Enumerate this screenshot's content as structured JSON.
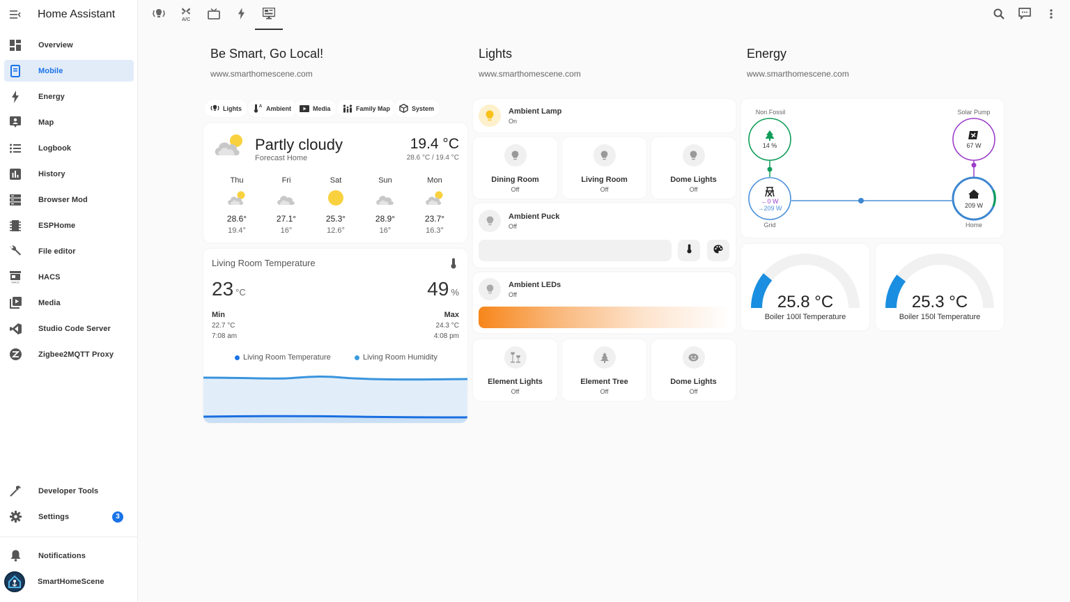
{
  "app": {
    "title": "Home Assistant"
  },
  "sidebar": {
    "items": [
      {
        "label": "Overview",
        "icon": "view-dashboard-icon",
        "active": false
      },
      {
        "label": "Mobile",
        "icon": "tablet-icon",
        "active": true
      },
      {
        "label": "Energy",
        "icon": "lightning-bolt-icon",
        "active": false
      },
      {
        "label": "Map",
        "icon": "map-account-icon",
        "active": false
      },
      {
        "label": "Logbook",
        "icon": "format-list-bulleted-icon",
        "active": false
      },
      {
        "label": "History",
        "icon": "chart-box-icon",
        "active": false
      },
      {
        "label": "Browser Mod",
        "icon": "server-icon",
        "active": false
      },
      {
        "label": "ESPHome",
        "icon": "chip-icon",
        "active": false
      },
      {
        "label": "File editor",
        "icon": "wrench-icon",
        "active": false
      },
      {
        "label": "HACS",
        "icon": "hacs-store-icon",
        "active": false
      },
      {
        "label": "Media",
        "icon": "play-box-multiple-icon",
        "active": false
      },
      {
        "label": "Studio Code Server",
        "icon": "vscode-icon",
        "active": false
      },
      {
        "label": "Zigbee2MQTT Proxy",
        "icon": "zigbee-icon",
        "active": false
      }
    ],
    "bottom": {
      "developer_tools": "Developer Tools",
      "settings": "Settings",
      "settings_badge": "3",
      "notifications": "Notifications",
      "user": "SmartHomeScene"
    }
  },
  "topbar": {
    "tabs": [
      {
        "icon": "lightbulb-group-icon",
        "active": false
      },
      {
        "icon": "air-conditioner-icon",
        "label": "A/C",
        "active": false
      },
      {
        "icon": "television-icon",
        "active": false
      },
      {
        "icon": "lightning-bolt-icon",
        "active": false
      },
      {
        "icon": "monitor-dashboard-icon",
        "active": true
      }
    ],
    "actions": [
      "search-icon",
      "assist-message-icon",
      "more-vertical-icon"
    ]
  },
  "columns": {
    "col1": {
      "title": "Be Smart, Go Local!",
      "subtitle": "www.smarthomescene.com"
    },
    "col2": {
      "title": "Lights",
      "subtitle": "www.smarthomescene.com"
    },
    "col3": {
      "title": "Energy",
      "subtitle": "www.smarthomescene.com"
    }
  },
  "chips": [
    {
      "label": "Lights",
      "icon": "lightbulb-group-icon"
    },
    {
      "label": "Ambient",
      "icon": "thermometer-auto-icon"
    },
    {
      "label": "Media",
      "icon": "youtube-tv-icon"
    },
    {
      "label": "Family Map",
      "icon": "family-icon"
    },
    {
      "label": "System",
      "icon": "package-icon"
    }
  ],
  "weather": {
    "condition": "Partly cloudy",
    "location": "Forecast Home",
    "temperature": "19.4 °C",
    "range": "28.6 °C / 19.4 °C",
    "forecast": [
      {
        "day": "Thu",
        "icon": "partly-cloudy",
        "high": "28.6°",
        "low": "19.4°"
      },
      {
        "day": "Fri",
        "icon": "cloudy",
        "high": "27.1°",
        "low": "16°"
      },
      {
        "day": "Sat",
        "icon": "sunny",
        "high": "25.3°",
        "low": "12.6°"
      },
      {
        "day": "Sun",
        "icon": "cloudy",
        "high": "28.9°",
        "low": "16°"
      },
      {
        "day": "Mon",
        "icon": "partly-cloudy",
        "high": "23.7°",
        "low": "16.3°"
      }
    ]
  },
  "sensor": {
    "title": "Living Room Temperature",
    "temp_value": "23",
    "temp_unit": "°C",
    "hum_value": "49",
    "hum_unit": "%",
    "min_label": "Min",
    "min_value": "22.7 °C",
    "min_time": "7:08 am",
    "max_label": "Max",
    "max_value": "24.3 °C",
    "max_time": "4:08 pm",
    "legend": [
      {
        "label": "Living Room Temperature",
        "color": "#1a73e8"
      },
      {
        "label": "Living Room Humidity",
        "color": "#3a9be0"
      }
    ]
  },
  "lights": {
    "ambient_lamp": {
      "name": "Ambient Lamp",
      "state": "On"
    },
    "row1": [
      {
        "name": "Dining Room",
        "state": "Off",
        "icon": "lightbulb-icon"
      },
      {
        "name": "Living Room",
        "state": "Off",
        "icon": "lightbulb-icon"
      },
      {
        "name": "Dome Lights",
        "state": "Off",
        "icon": "lightbulb-icon"
      }
    ],
    "ambient_puck": {
      "name": "Ambient Puck",
      "state": "Off"
    },
    "ambient_leds": {
      "name": "Ambient LEDs",
      "state": "Off"
    },
    "row2": [
      {
        "name": "Element Lights",
        "state": "Off",
        "icon": "floor-lamp-icon"
      },
      {
        "name": "Element Tree",
        "state": "Off",
        "icon": "pine-tree-icon"
      },
      {
        "name": "Dome Lights",
        "state": "Off",
        "icon": "dome-light-icon"
      }
    ]
  },
  "energy": {
    "non_fossil": {
      "label": "Non Fossil",
      "value": "14 %"
    },
    "solar": {
      "label": "Solar Pump",
      "value": "67 W"
    },
    "grid": {
      "label": "Grid",
      "return": "←0 W",
      "consumption": "→209 W"
    },
    "home": {
      "label": "Home",
      "value": "209 W"
    },
    "colors": {
      "non_fossil": "#0f9d58",
      "solar": "#9b3fc9",
      "grid": "#4a90d9"
    }
  },
  "gauges": [
    {
      "value": "25.8 °C",
      "name": "Boiler 100l Temperature",
      "fraction": 0.22
    },
    {
      "value": "25.3 °C",
      "name": "Boiler 150l Temperature",
      "fraction": 0.21
    }
  ]
}
